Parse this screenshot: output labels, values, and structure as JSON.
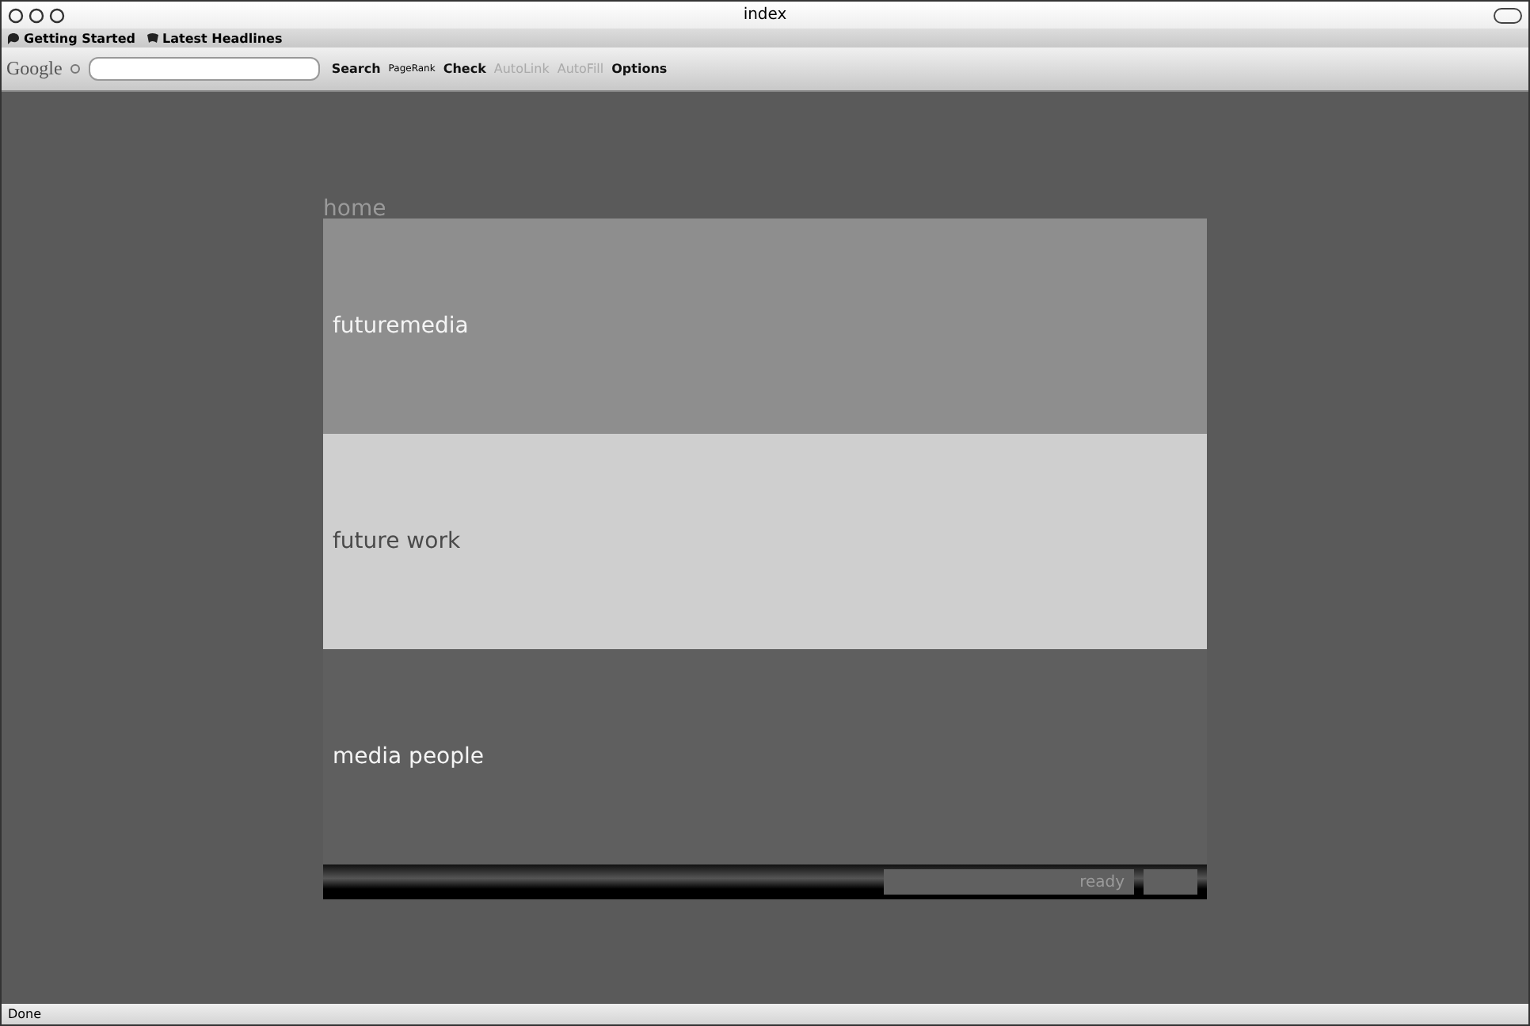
{
  "window": {
    "title": "index"
  },
  "bookmarks": [
    "Getting Started",
    "Latest Headlines"
  ],
  "toolbar": {
    "logo": "Google",
    "search_button": "Search",
    "pagerank": "PageRank",
    "check": "Check",
    "items": [
      {
        "label": "AutoLink",
        "disabled": true
      },
      {
        "label": "AutoFill",
        "disabled": true
      },
      {
        "label": "Options",
        "disabled": false
      }
    ]
  },
  "page": {
    "heading": "home",
    "panels": [
      {
        "label": "futuremedia",
        "color": "#8e8e8e"
      },
      {
        "label": "future work",
        "color": "#cfcfcf"
      },
      {
        "label": "media people",
        "color": "#5f5f5f"
      }
    ],
    "loader": {
      "status": "ready"
    }
  },
  "status_bar": "Done"
}
